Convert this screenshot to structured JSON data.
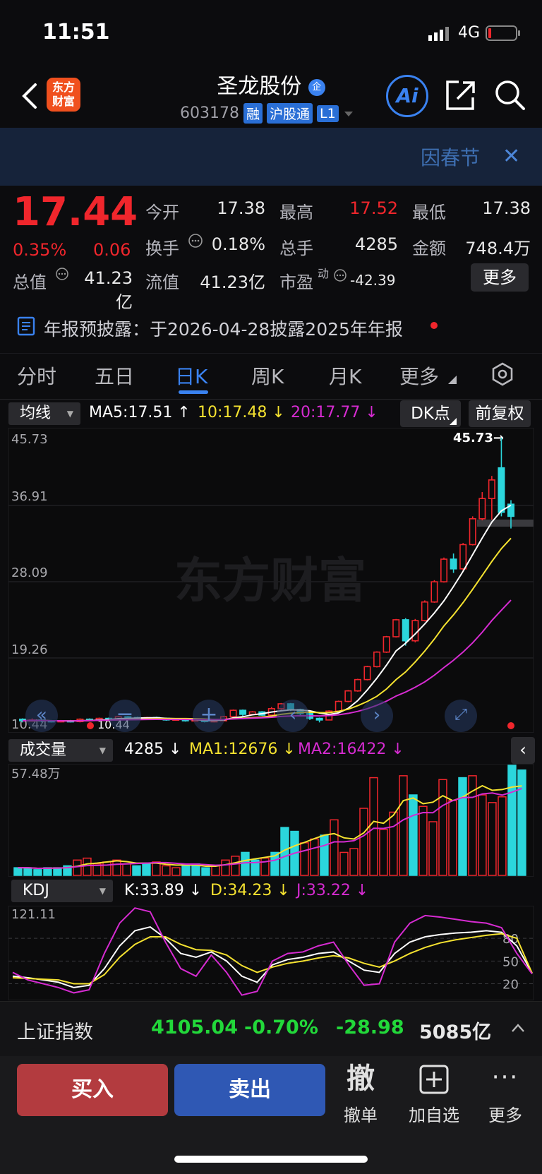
{
  "status": {
    "time": "11:51",
    "network": "4G"
  },
  "header": {
    "logo_line1": "东方",
    "logo_line2": "财富",
    "stock_name": "圣龙股份",
    "stock_badge": "企",
    "stock_code": "603178",
    "tags": [
      "融",
      "沪股通",
      "L1"
    ],
    "ai_label": "Ai"
  },
  "banner": {
    "text": "因春节"
  },
  "quote": {
    "price": "17.44",
    "change_pct": "0.35%",
    "change_abs": "0.06",
    "open_label": "今开",
    "open": "17.38",
    "high_label": "最高",
    "high": "17.52",
    "low_label": "最低",
    "low": "17.38",
    "turnover_label": "换手",
    "turnover": "0.18%",
    "volume_label": "总手",
    "volume": "4285",
    "amount_label": "金额",
    "amount": "748.4万",
    "mktcap_label": "总值",
    "mktcap": "41.23亿",
    "float_label": "流值",
    "float_cap": "41.23亿",
    "pe_label": "市盈",
    "pe_sup": "动",
    "pe": "-42.39",
    "more": "更多"
  },
  "notice": {
    "text": "年报预披露：于2026-04-28披露2025年年报"
  },
  "tabs": [
    "分时",
    "五日",
    "日K",
    "周K",
    "月K",
    "更多"
  ],
  "active_tab": "日K",
  "ma": {
    "select": "均线",
    "ma5": "MA5:17.51",
    "ma10": "10:17.48",
    "ma20": "20:17.77",
    "dk": "DK点",
    "adjust": "前复权"
  },
  "price_axis": [
    "45.73",
    "36.91",
    "28.09",
    "19.26",
    "10.44"
  ],
  "price_marker_high": "45.73→",
  "price_marker_low": "10.44",
  "watermark": "东方财富",
  "volume": {
    "select": "成交量",
    "vol": "4285",
    "ma1": "MA1:12676",
    "ma2": "MA2:16422",
    "axis_top": "57.48万"
  },
  "kdj": {
    "select": "KDJ",
    "k": "K:33.89",
    "d": "D:34.23",
    "j": "J:33.22",
    "axis_top": "121.11",
    "levels": [
      "80",
      "50",
      "20"
    ]
  },
  "index_bar": {
    "name": "上证指数",
    "value": "4105.04",
    "pct": "-0.70%",
    "change": "-28.98",
    "amount": "5085亿"
  },
  "trade": {
    "buy": "买入",
    "sell": "卖出",
    "cancel_icon": "撤",
    "cancel": "撤单",
    "watch": "加自选",
    "more": "更多"
  },
  "colors": {
    "up": "#f0262c",
    "down": "#2bd6dc",
    "ma5": "#ffffff",
    "ma10": "#f5e230",
    "ma20": "#d62bd1",
    "accent": "#3a82f0"
  },
  "chart_data": [
    {
      "type": "candlestick",
      "title": "",
      "ylim": [
        10.44,
        45.73
      ],
      "yticks": [
        45.73,
        36.91,
        28.09,
        19.26,
        10.44
      ],
      "candles": [
        [
          10.9,
          10.7,
          11.0,
          10.5
        ],
        [
          10.7,
          10.8,
          11.0,
          10.6
        ],
        [
          10.8,
          10.7,
          10.9,
          10.5
        ],
        [
          10.7,
          10.6,
          10.8,
          10.5
        ],
        [
          10.6,
          10.7,
          10.8,
          10.5
        ],
        [
          10.7,
          10.6,
          10.8,
          10.5
        ],
        [
          10.6,
          10.9,
          11.0,
          10.5
        ],
        [
          10.9,
          10.8,
          11.0,
          10.7
        ],
        [
          10.8,
          11.0,
          11.1,
          10.7
        ],
        [
          11.0,
          10.9,
          11.1,
          10.8
        ],
        [
          10.9,
          11.2,
          11.3,
          10.9
        ],
        [
          11.2,
          11.1,
          11.3,
          11.0
        ],
        [
          11.1,
          11.0,
          11.2,
          10.9
        ],
        [
          11.0,
          11.1,
          11.2,
          10.9
        ],
        [
          11.1,
          11.0,
          11.2,
          10.9
        ],
        [
          11.0,
          10.8,
          11.1,
          10.7
        ],
        [
          10.8,
          10.9,
          11.0,
          10.7
        ],
        [
          10.9,
          10.7,
          11.0,
          10.6
        ],
        [
          10.7,
          10.8,
          10.9,
          10.6
        ],
        [
          10.8,
          10.6,
          10.9,
          10.5
        ],
        [
          10.6,
          10.7,
          10.8,
          10.5
        ],
        [
          10.7,
          11.2,
          11.3,
          10.7
        ],
        [
          11.2,
          12.0,
          12.1,
          11.1
        ],
        [
          12.0,
          11.5,
          12.1,
          11.3
        ],
        [
          11.5,
          11.8,
          11.9,
          11.4
        ],
        [
          11.8,
          11.4,
          11.9,
          11.3
        ],
        [
          11.4,
          12.2,
          12.4,
          11.4
        ],
        [
          12.2,
          12.8,
          12.9,
          12.0
        ],
        [
          12.8,
          12.1,
          12.9,
          11.9
        ],
        [
          12.1,
          11.6,
          12.2,
          11.4
        ],
        [
          11.6,
          11.0,
          11.7,
          10.8
        ],
        [
          11.0,
          10.8,
          11.1,
          10.5
        ],
        [
          10.8,
          11.9,
          12.0,
          10.8
        ],
        [
          11.9,
          13.1,
          13.2,
          11.9
        ],
        [
          13.1,
          14.4,
          14.5,
          13.0
        ],
        [
          14.4,
          15.8,
          15.9,
          14.3
        ],
        [
          15.8,
          17.4,
          17.5,
          15.7
        ],
        [
          17.4,
          19.2,
          19.3,
          17.3
        ],
        [
          19.2,
          21.1,
          21.2,
          19.1
        ],
        [
          21.1,
          23.2,
          23.3,
          21.0
        ],
        [
          23.2,
          20.6,
          23.4,
          20.0
        ],
        [
          20.6,
          23.1,
          23.3,
          20.4
        ],
        [
          23.1,
          25.4,
          25.6,
          23.0
        ],
        [
          25.4,
          27.9,
          28.1,
          25.3
        ],
        [
          27.9,
          30.7,
          30.9,
          27.8
        ],
        [
          30.7,
          29.5,
          31.4,
          29.0
        ],
        [
          29.5,
          32.5,
          32.7,
          29.3
        ],
        [
          32.5,
          35.7,
          36.0,
          32.4
        ],
        [
          35.7,
          38.2,
          39.0,
          35.5
        ],
        [
          38.2,
          40.5,
          41.0,
          35.6
        ],
        [
          42.0,
          36.5,
          45.73,
          36.0
        ],
        [
          37.5,
          36.0,
          38.0,
          34.5
        ]
      ],
      "ma5_label": "MA5:17.51",
      "ma10_label": "10:17.48",
      "ma20_label": "20:17.77"
    },
    {
      "type": "bar",
      "title": "成交量",
      "ylim": [
        0,
        57.48
      ],
      "values": [
        4,
        4,
        3,
        4,
        4,
        5,
        8,
        9,
        6,
        7,
        8,
        6,
        5,
        6,
        7,
        5,
        4,
        5,
        6,
        4,
        5,
        8,
        10,
        12,
        8,
        9,
        12,
        25,
        23,
        17,
        19,
        21,
        29,
        12,
        14,
        35,
        51,
        24,
        33,
        52,
        42,
        36,
        28,
        50,
        39,
        51,
        52,
        42,
        38,
        41,
        57.48,
        55
      ],
      "colors": [
        "down",
        "down",
        "down",
        "down",
        "down",
        "down",
        "up",
        "up",
        "up",
        "up",
        "up",
        "up",
        "down",
        "down",
        "up",
        "up",
        "up",
        "down",
        "down",
        "down",
        "up",
        "up",
        "up",
        "down",
        "down",
        "up",
        "down",
        "down",
        "down",
        "up",
        "up",
        "down",
        "up",
        "up",
        "up",
        "up",
        "up",
        "up",
        "up",
        "up",
        "down",
        "up",
        "up",
        "up",
        "up",
        "down",
        "up",
        "up",
        "up",
        "up",
        "down",
        "down"
      ]
    },
    {
      "type": "line",
      "title": "KDJ",
      "ylim": [
        0,
        121.11
      ],
      "levels": [
        80,
        50,
        20
      ],
      "series": [
        {
          "name": "K",
          "values": [
            30,
            28,
            25,
            22,
            15,
            18,
            40,
            70,
            90,
            95,
            80,
            60,
            55,
            62,
            50,
            30,
            22,
            45,
            52,
            55,
            60,
            62,
            50,
            38,
            35,
            60,
            75,
            82,
            85,
            87,
            88,
            90,
            88,
            70,
            34
          ]
        },
        {
          "name": "D",
          "values": [
            28,
            27,
            26,
            25,
            20,
            20,
            32,
            55,
            72,
            82,
            82,
            72,
            65,
            64,
            58,
            44,
            35,
            42,
            47,
            50,
            54,
            57,
            54,
            47,
            42,
            50,
            60,
            68,
            74,
            78,
            81,
            84,
            86,
            80,
            34
          ]
        },
        {
          "name": "J",
          "values": [
            35,
            25,
            20,
            15,
            8,
            12,
            60,
            100,
            120,
            115,
            75,
            40,
            30,
            58,
            35,
            5,
            10,
            50,
            60,
            62,
            70,
            75,
            45,
            18,
            20,
            75,
            100,
            110,
            108,
            105,
            102,
            100,
            94,
            60,
            33
          ]
        }
      ]
    }
  ]
}
